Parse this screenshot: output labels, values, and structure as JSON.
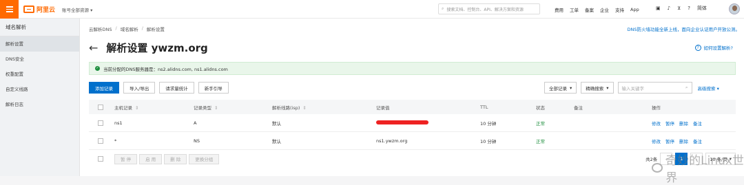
{
  "topbar": {
    "logo_text": "阿里云",
    "account": "账号全部资源",
    "search_placeholder": "搜索文档、控制台、API、解决方案和资源",
    "links": [
      "费用",
      "工单",
      "备案",
      "企业",
      "支持",
      "App"
    ],
    "lang": "简体"
  },
  "sidebar": {
    "title": "域名解析",
    "items": [
      "解析设置",
      "DNS安全",
      "权重配置",
      "自定义线路",
      "解析日志"
    ]
  },
  "breadcrumb": [
    "云解析DNS",
    "域名解析",
    "解析设置"
  ],
  "notice": "DNS防火墙功能全新上线，面向企业认证用户开放公测。",
  "page": {
    "title": "解析设置 ywzm.org",
    "help": "如何设置解析?"
  },
  "dns_banner": "当前分配的DNS服务器是：ns2.alidns.com, ns1.alidns.com",
  "toolbar": {
    "add": "添加记录",
    "import": "导入/导出",
    "stats": "请求量统计",
    "guide": "新手引导"
  },
  "filter": {
    "all_records": "全部记录",
    "precise": "精确搜索",
    "keyword_placeholder": "输入关键字",
    "advanced": "高级搜索"
  },
  "table": {
    "headers": {
      "host": "主机记录",
      "type": "记录类型",
      "line": "解析线路(isp)",
      "value": "记录值",
      "ttl": "TTL",
      "status": "状态",
      "note": "备注",
      "ops": "操作"
    },
    "rows": [
      {
        "host": "ns1",
        "type": "A",
        "line": "默认",
        "value": "",
        "ttl": "10 分钟",
        "status": "正常",
        "note": "",
        "ops": [
          "修改",
          "暂停",
          "删除",
          "备注"
        ]
      },
      {
        "host": "*",
        "type": "NS",
        "line": "默认",
        "value": "ns1.ywzm.org",
        "ttl": "10 分钟",
        "status": "正常",
        "note": "",
        "ops": [
          "修改",
          "暂停",
          "删除",
          "备注"
        ]
      }
    ]
  },
  "footer": {
    "batch": [
      "暂 停",
      "启 用",
      "删 除",
      "更换分组"
    ],
    "total": "共2条",
    "current_page": "1",
    "page_size": "10 条/页"
  },
  "watermark": "奇妙的Linux世界"
}
